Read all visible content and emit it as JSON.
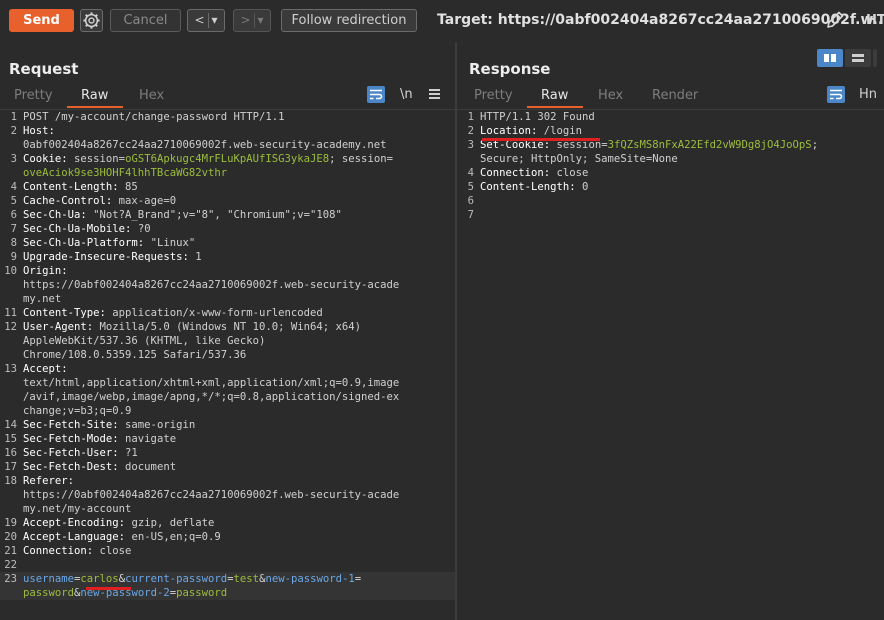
{
  "toolbar": {
    "send": "Send",
    "cancel": "Cancel",
    "back": "<",
    "back_dropdown": "▾",
    "forward": ">",
    "forward_dropdown": "▾",
    "follow_redirection": "Follow redirection",
    "target": "Target: https://0abf002404a8267cc24aa2710069002f.w...",
    "overflow_text": "HT"
  },
  "request": {
    "title": "Request",
    "tabs": [
      "Pretty",
      "Raw",
      "Hex"
    ],
    "active_tab": "Raw",
    "newline_toggle": "\\n"
  },
  "response": {
    "title": "Response",
    "tabs": [
      "Pretty",
      "Raw",
      "Hex",
      "Render"
    ],
    "active_tab": "Raw",
    "newline_toggle": "\\n",
    "overflow_text": "Hn"
  },
  "request_lines": [
    {
      "ln": "1",
      "segs": [
        {
          "t": "POST /my-account/change-password HTTP/1.1",
          "c": "hv"
        }
      ]
    },
    {
      "ln": "2",
      "segs": [
        {
          "t": "Host:",
          "c": "hn"
        }
      ]
    },
    {
      "ln": "",
      "segs": [
        {
          "t": "0abf002404a8267cc24aa2710069002f.web-security-academy.net",
          "c": "hv"
        }
      ]
    },
    {
      "ln": "3",
      "segs": [
        {
          "t": "Cookie:",
          "c": "hn"
        },
        {
          "t": " session=",
          "c": "hv"
        },
        {
          "t": "oGST6Apkugc4MrFLuKpAUfISG3ykaJE8",
          "c": "cv"
        },
        {
          "t": "; session=",
          "c": "hv"
        }
      ]
    },
    {
      "ln": "",
      "segs": [
        {
          "t": "oveAciok9se3HOHF4lhhTBcaWG82vthr",
          "c": "cv"
        }
      ]
    },
    {
      "ln": "4",
      "segs": [
        {
          "t": "Content-Length:",
          "c": "hn"
        },
        {
          "t": " 85",
          "c": "hv"
        }
      ]
    },
    {
      "ln": "5",
      "segs": [
        {
          "t": "Cache-Control:",
          "c": "hn"
        },
        {
          "t": " max-age=0",
          "c": "hv"
        }
      ]
    },
    {
      "ln": "6",
      "segs": [
        {
          "t": "Sec-Ch-Ua:",
          "c": "hn"
        },
        {
          "t": " \"Not?A_Brand\";v=\"8\", \"Chromium\";v=\"108\"",
          "c": "hv"
        }
      ]
    },
    {
      "ln": "7",
      "segs": [
        {
          "t": "Sec-Ch-Ua-Mobile:",
          "c": "hn"
        },
        {
          "t": " ?0",
          "c": "hv"
        }
      ]
    },
    {
      "ln": "8",
      "segs": [
        {
          "t": "Sec-Ch-Ua-Platform:",
          "c": "hn"
        },
        {
          "t": " \"Linux\"",
          "c": "hv"
        }
      ]
    },
    {
      "ln": "9",
      "segs": [
        {
          "t": "Upgrade-Insecure-Requests:",
          "c": "hn"
        },
        {
          "t": " 1",
          "c": "hv"
        }
      ]
    },
    {
      "ln": "10",
      "segs": [
        {
          "t": "Origin:",
          "c": "hn"
        }
      ]
    },
    {
      "ln": "",
      "segs": [
        {
          "t": "https://0abf002404a8267cc24aa2710069002f.web-security-acade",
          "c": "hv"
        }
      ]
    },
    {
      "ln": "",
      "segs": [
        {
          "t": "my.net",
          "c": "hv"
        }
      ]
    },
    {
      "ln": "11",
      "segs": [
        {
          "t": "Content-Type:",
          "c": "hn"
        },
        {
          "t": " application/x-www-form-urlencoded",
          "c": "hv"
        }
      ]
    },
    {
      "ln": "12",
      "segs": [
        {
          "t": "User-Agent:",
          "c": "hn"
        },
        {
          "t": " Mozilla/5.0 (Windows NT 10.0; Win64; x64)",
          "c": "hv"
        }
      ]
    },
    {
      "ln": "",
      "segs": [
        {
          "t": "AppleWebKit/537.36 (KHTML, like Gecko)",
          "c": "hv"
        }
      ]
    },
    {
      "ln": "",
      "segs": [
        {
          "t": "Chrome/108.0.5359.125 Safari/537.36",
          "c": "hv"
        }
      ]
    },
    {
      "ln": "13",
      "segs": [
        {
          "t": "Accept:",
          "c": "hn"
        }
      ]
    },
    {
      "ln": "",
      "segs": [
        {
          "t": "text/html,application/xhtml+xml,application/xml;q=0.9,image",
          "c": "hv"
        }
      ]
    },
    {
      "ln": "",
      "segs": [
        {
          "t": "/avif,image/webp,image/apng,*/*;q=0.8,application/signed-ex",
          "c": "hv"
        }
      ]
    },
    {
      "ln": "",
      "segs": [
        {
          "t": "change;v=b3;q=0.9",
          "c": "hv"
        }
      ]
    },
    {
      "ln": "14",
      "segs": [
        {
          "t": "Sec-Fetch-Site:",
          "c": "hn"
        },
        {
          "t": " same-origin",
          "c": "hv"
        }
      ]
    },
    {
      "ln": "15",
      "segs": [
        {
          "t": "Sec-Fetch-Mode:",
          "c": "hn"
        },
        {
          "t": " navigate",
          "c": "hv"
        }
      ]
    },
    {
      "ln": "16",
      "segs": [
        {
          "t": "Sec-Fetch-User:",
          "c": "hn"
        },
        {
          "t": " ?1",
          "c": "hv"
        }
      ]
    },
    {
      "ln": "17",
      "segs": [
        {
          "t": "Sec-Fetch-Dest:",
          "c": "hn"
        },
        {
          "t": " document",
          "c": "hv"
        }
      ]
    },
    {
      "ln": "18",
      "segs": [
        {
          "t": "Referer:",
          "c": "hn"
        }
      ]
    },
    {
      "ln": "",
      "segs": [
        {
          "t": "https://0abf002404a8267cc24aa2710069002f.web-security-acade",
          "c": "hv"
        }
      ]
    },
    {
      "ln": "",
      "segs": [
        {
          "t": "my.net/my-account",
          "c": "hv"
        }
      ]
    },
    {
      "ln": "19",
      "segs": [
        {
          "t": "Accept-Encoding:",
          "c": "hn"
        },
        {
          "t": " gzip, deflate",
          "c": "hv"
        }
      ]
    },
    {
      "ln": "20",
      "segs": [
        {
          "t": "Accept-Language:",
          "c": "hn"
        },
        {
          "t": " en-US,en;q=0.9",
          "c": "hv"
        }
      ]
    },
    {
      "ln": "21",
      "segs": [
        {
          "t": "Connection:",
          "c": "hn"
        },
        {
          "t": " close",
          "c": "hv"
        }
      ]
    },
    {
      "ln": "22",
      "segs": []
    },
    {
      "ln": "23",
      "hl": true,
      "segs": [
        {
          "t": "username",
          "c": "pk"
        },
        {
          "t": "=",
          "c": "pt"
        },
        {
          "t": "carlos",
          "c": "pv"
        },
        {
          "t": "&",
          "c": "pt"
        },
        {
          "t": "current-password",
          "c": "pk"
        },
        {
          "t": "=",
          "c": "pt"
        },
        {
          "t": "test",
          "c": "pv"
        },
        {
          "t": "&",
          "c": "pt"
        },
        {
          "t": "new-password-1",
          "c": "pk"
        },
        {
          "t": "=",
          "c": "pt"
        }
      ]
    },
    {
      "ln": "",
      "hl": true,
      "segs": [
        {
          "t": "password",
          "c": "pv"
        },
        {
          "t": "&",
          "c": "pt"
        },
        {
          "t": "new-password-2",
          "c": "pk"
        },
        {
          "t": "=",
          "c": "pt"
        },
        {
          "t": "password",
          "c": "pv"
        }
      ]
    }
  ],
  "response_lines": [
    {
      "ln": "1",
      "segs": [
        {
          "t": "HTTP/1.1 302 Found",
          "c": "hv"
        }
      ]
    },
    {
      "ln": "2",
      "segs": [
        {
          "t": "Location:",
          "c": "hn"
        },
        {
          "t": " /login",
          "c": "hv"
        }
      ]
    },
    {
      "ln": "3",
      "segs": [
        {
          "t": "Set-Cookie:",
          "c": "hn"
        },
        {
          "t": " session=",
          "c": "hv"
        },
        {
          "t": "3fQZsMS8nFxA22Efd2vW9Dg8jO4JoOpS",
          "c": "cv"
        },
        {
          "t": ";",
          "c": "hv"
        }
      ]
    },
    {
      "ln": "",
      "segs": [
        {
          "t": "Secure; HttpOnly; SameSite=None",
          "c": "hv"
        }
      ]
    },
    {
      "ln": "4",
      "segs": [
        {
          "t": "Connection:",
          "c": "hn"
        },
        {
          "t": " close",
          "c": "hv"
        }
      ]
    },
    {
      "ln": "5",
      "segs": [
        {
          "t": "Content-Length:",
          "c": "hn"
        },
        {
          "t": " 0",
          "c": "hv"
        }
      ]
    },
    {
      "ln": "6",
      "segs": []
    },
    {
      "ln": "7",
      "segs": []
    }
  ]
}
